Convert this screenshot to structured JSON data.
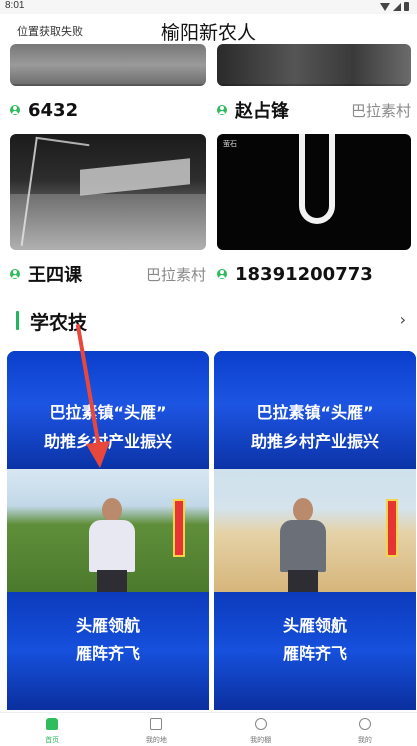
{
  "status_bar": {
    "time": "8:01"
  },
  "header": {
    "location": "位置获取失败",
    "title": "榆阳新农人"
  },
  "cameras": [
    {
      "name": "6432",
      "village": ""
    },
    {
      "name": "赵占锋",
      "village": "巴拉素村"
    },
    {
      "name": "王四课",
      "village": "巴拉素村"
    },
    {
      "name": "18391200773",
      "village": ""
    }
  ],
  "camera_overlays": {
    "mid_right_tag": "萤石"
  },
  "section": {
    "title": "学农技",
    "more_icon": "chevron-right-icon",
    "more_glyph": "›"
  },
  "videos": [
    {
      "headline_1": "巴拉素镇“头雁”",
      "headline_2": "助推乡村产业振兴",
      "footer_1": "头雁领航",
      "footer_2": "雁阵齐飞"
    },
    {
      "headline_1": "巴拉素镇“头雁”",
      "headline_2": "助推乡村产业振兴",
      "footer_1": "头雁领航",
      "footer_2": "雁阵齐飞"
    }
  ],
  "tabbar": [
    {
      "label": "首页",
      "icon": "home-icon"
    },
    {
      "label": "我的地",
      "icon": "land-icon"
    },
    {
      "label": "我的棚",
      "icon": "shed-icon"
    },
    {
      "label": "我的",
      "icon": "profile-icon"
    }
  ],
  "colors": {
    "accent": "#2ebc5e",
    "video_blue": "#1650dc",
    "arrow": "#e8483c"
  }
}
